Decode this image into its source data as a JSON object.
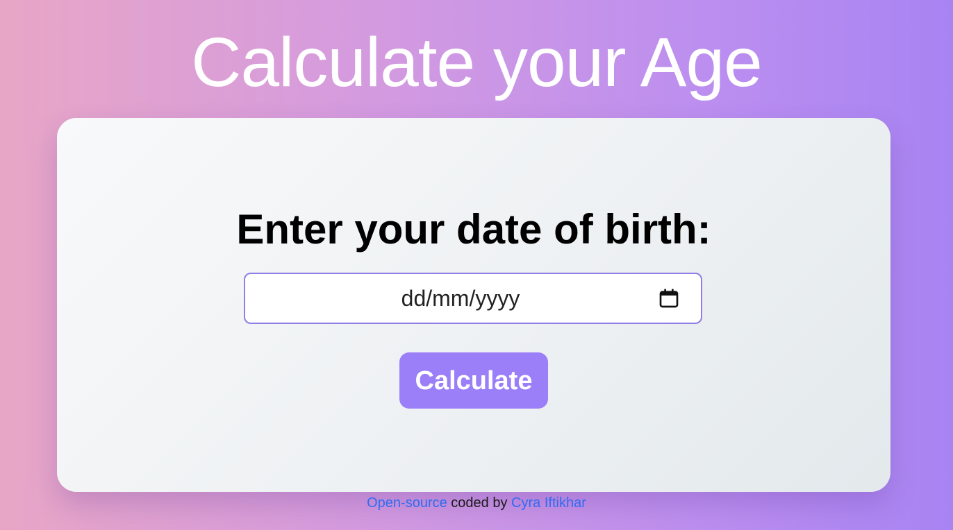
{
  "header": {
    "title": "Calculate your Age"
  },
  "card": {
    "prompt": "Enter your date of birth:",
    "date_input": {
      "placeholder": "dd/mm/yyyy",
      "value": ""
    },
    "button_label": "Calculate"
  },
  "footer": {
    "link1": "Open-source",
    "text": " coded by ",
    "link2": "Cyra Iftikhar"
  },
  "colors": {
    "accent": "#9b7ff9",
    "link": "#2f6cf0",
    "input_border": "#8f7ee6"
  },
  "icons": {
    "date_picker": "calendar-icon"
  }
}
